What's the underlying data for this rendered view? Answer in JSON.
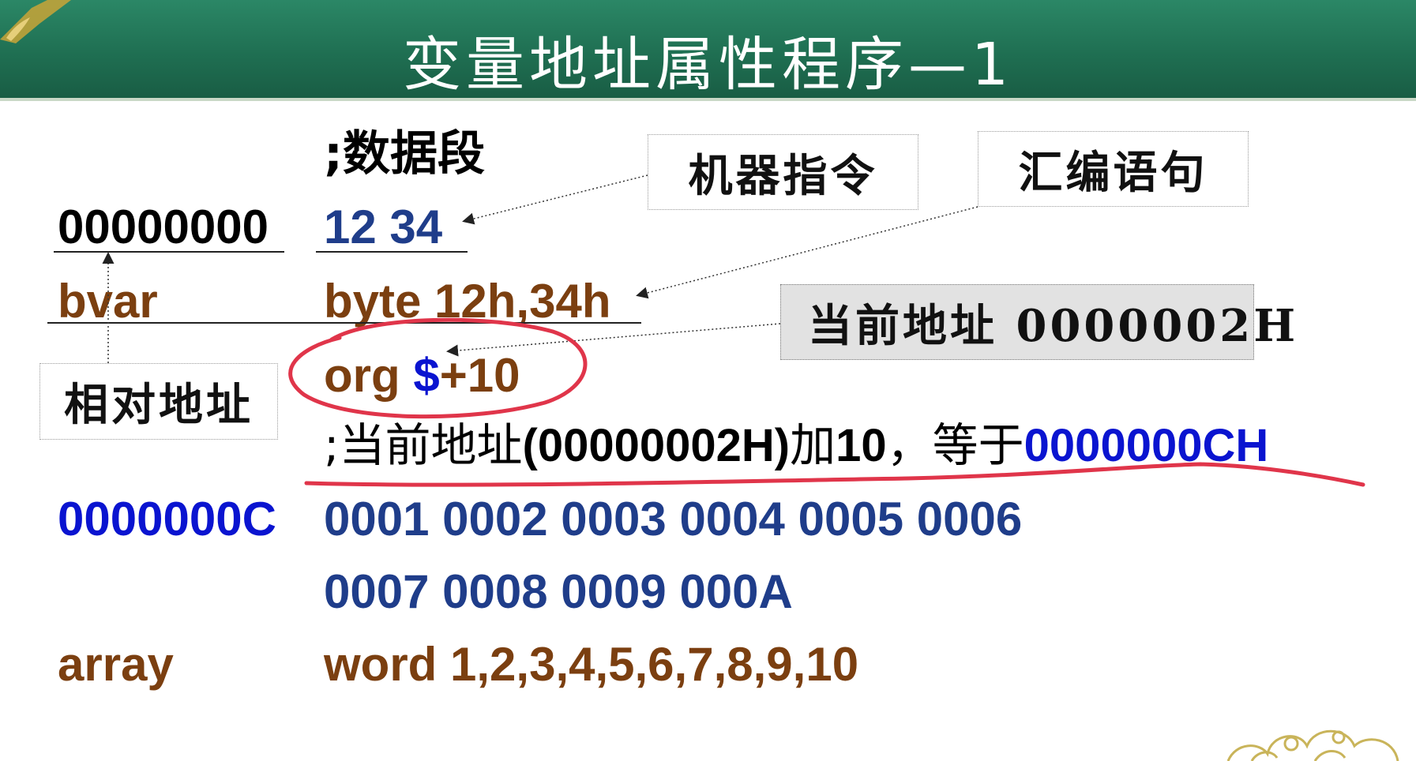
{
  "title": "变量地址属性程序—1",
  "rows": {
    "comment_data_segment": ";数据段",
    "addr_0": "00000000",
    "bytes_0": "12 34",
    "bvar_label": "bvar",
    "bvar_def": "byte 12h,34h",
    "org_prefix": "org ",
    "org_dollar": "$",
    "org_suffix": "+10",
    "comment_prefix": ";当前地址",
    "comment_addr": "(00000002H)",
    "comment_mid": "加",
    "comment_ten": "10",
    "comment_eq": "，等于",
    "comment_result": "0000000CH",
    "addr_c": "0000000C",
    "words_line1": "0001 0002 0003 0004 0005 0006",
    "words_line2": "0007 0008 0009 000A",
    "array_label": "array",
    "array_def": "word 1,2,3,4,5,6,7,8,9,10"
  },
  "callouts": {
    "machine_instruction": "机器指令",
    "assembly_statement": "汇编语句",
    "current_address": "当前地址 0000002H",
    "relative_address": "相对地址"
  },
  "colors": {
    "header": "#1f6f52",
    "label_brown": "#7b3f10",
    "code_navy": "#1f3d8a",
    "highlight_blue": "#0a14d0",
    "annotation_red": "#e0354a"
  }
}
